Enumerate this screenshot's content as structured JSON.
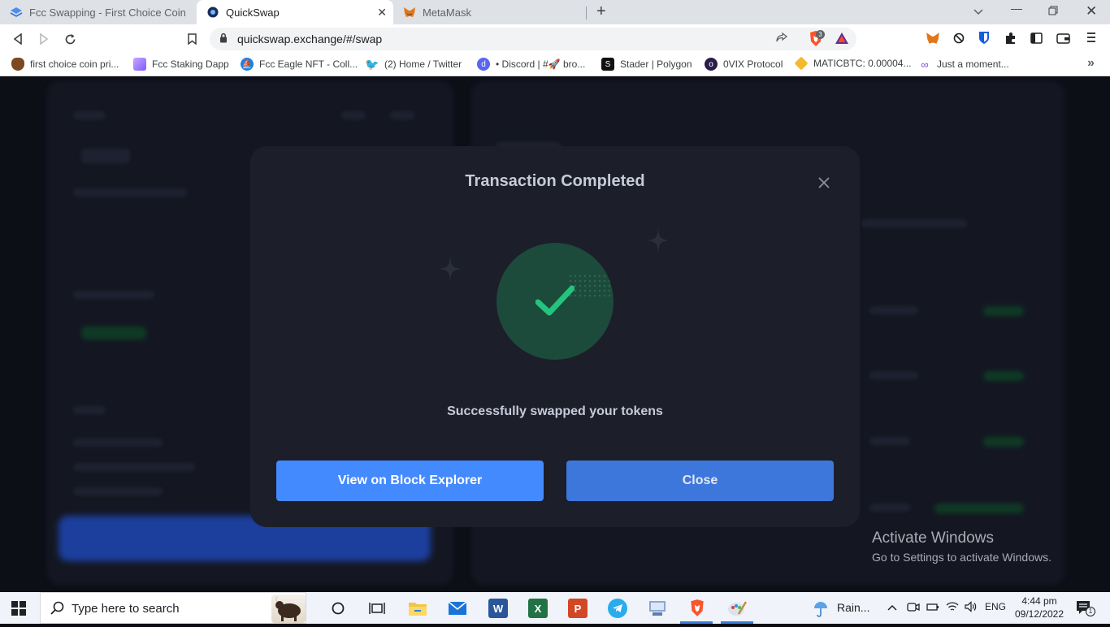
{
  "browser": {
    "tabs": [
      {
        "title": "Fcc Swapping - First Choice Coin",
        "active": false,
        "favicon": "layers-icon"
      },
      {
        "title": "QuickSwap",
        "active": true,
        "favicon": "quickswap-icon"
      },
      {
        "title": "MetaMask",
        "active": false,
        "favicon": "metamask-fox-icon"
      }
    ],
    "url": "quickswap.exchange/#/swap",
    "brave_shield_count": "3",
    "bookmarks": [
      "first choice coin pri...",
      "Fcc Staking Dapp",
      "Fcc Eagle NFT - Coll...",
      "(2) Home / Twitter",
      "• Discord | #🚀 bro...",
      "Stader | Polygon",
      "0VIX Protocol",
      "MATICBTC: 0.00004...",
      "Just a moment..."
    ]
  },
  "modal": {
    "title": "Transaction Completed",
    "message": "Successfully swapped your tokens",
    "explorer_button": "View on Block Explorer",
    "close_button": "Close",
    "success_color": "#23c47d",
    "primary_color": "#448aff"
  },
  "watermark": {
    "title": "Activate Windows",
    "subtitle": "Go to Settings to activate Windows."
  },
  "taskbar": {
    "search_placeholder": "Type here to search",
    "weather": "Rain...",
    "language": "ENG",
    "time": "4:44 pm",
    "date": "09/12/2022",
    "notification_count": "1"
  }
}
